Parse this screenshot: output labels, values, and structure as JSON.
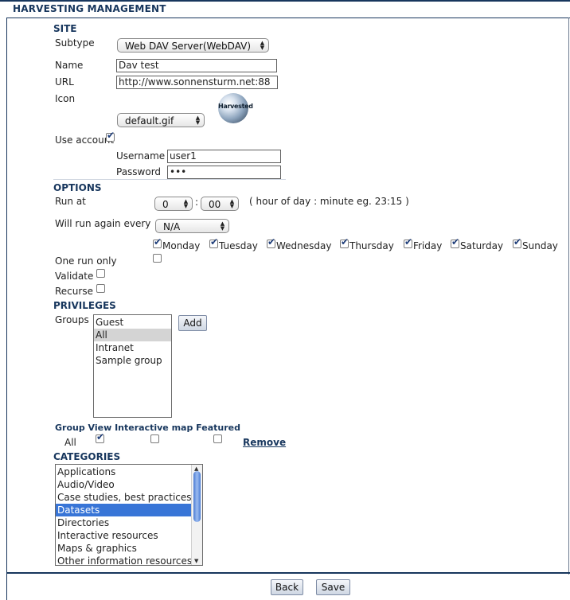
{
  "page": {
    "title": "HARVESTING MANAGEMENT"
  },
  "site": {
    "heading": "SITE",
    "subtype_label": "Subtype",
    "subtype_value": "Web DAV Server(WebDAV)",
    "name_label": "Name",
    "name_value": "Dav test",
    "url_label": "URL",
    "url_value": "http://www.sonnensturm.net:88",
    "icon_label": "Icon",
    "icon_caption": "Harvested",
    "icon_select": "default.gif",
    "use_account_label": "Use account",
    "use_account_checked": true,
    "username_label": "Username",
    "username_value": "user1",
    "password_label": "Password",
    "password_value": "•••"
  },
  "options": {
    "heading": "OPTIONS",
    "run_at_label": "Run at",
    "hour_value": "0",
    "minute_value": "00",
    "time_hint": "( hour of day : minute eg. 23:15 )",
    "run_again_label": "Will run again every",
    "run_again_value": "N/A",
    "days": [
      {
        "label": "Monday",
        "checked": true
      },
      {
        "label": "Tuesday",
        "checked": true
      },
      {
        "label": "Wednesday",
        "checked": true
      },
      {
        "label": "Thursday",
        "checked": true
      },
      {
        "label": "Friday",
        "checked": true
      },
      {
        "label": "Saturday",
        "checked": true
      },
      {
        "label": "Sunday",
        "checked": true
      }
    ],
    "one_run_only_label": "One run only",
    "validate_label": "Validate",
    "recurse_label": "Recurse"
  },
  "privileges": {
    "heading": "PRIVILEGES",
    "groups_label": "Groups",
    "groups": [
      "Guest",
      "All",
      "Intranet",
      "Sample group"
    ],
    "selected_group": "All",
    "add_label": "Add",
    "table_header": "Group View Interactive map Featured",
    "row_group": "All",
    "remove_label": "Remove"
  },
  "categories": {
    "heading": "CATEGORIES",
    "items": [
      "Applications",
      "Audio/Video",
      "Case studies, best practices",
      "Datasets",
      "Directories",
      "Interactive resources",
      "Maps & graphics",
      "Other information resources"
    ],
    "selected": "Datasets"
  },
  "footer": {
    "back_label": "Back",
    "save_label": "Save"
  }
}
